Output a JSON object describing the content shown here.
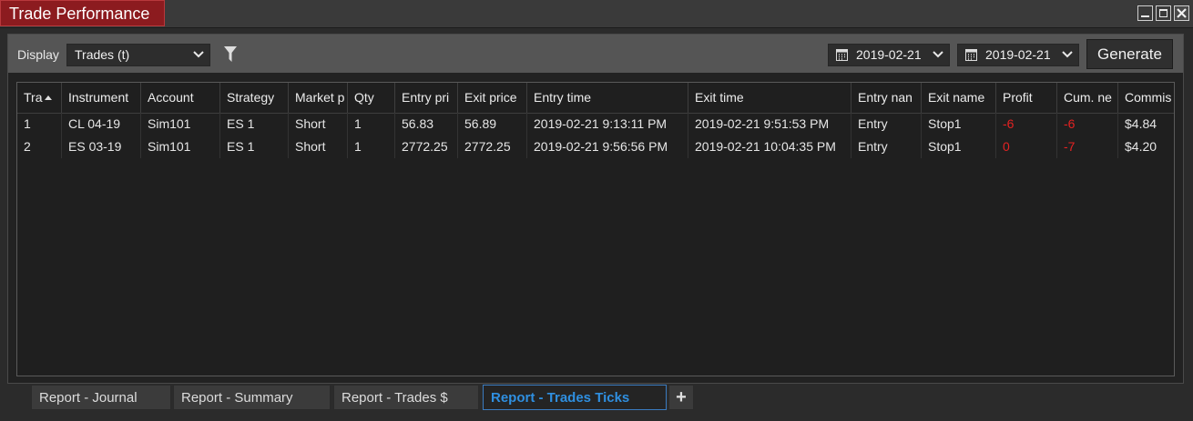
{
  "window": {
    "title": "Trade Performance"
  },
  "toolbar": {
    "display_label": "Display",
    "display_value": "Trades (t)",
    "date_from": "2019-02-21",
    "date_to": "2019-02-21",
    "generate_label": "Generate"
  },
  "grid": {
    "columns": [
      "Tra",
      "Instrument",
      "Account",
      "Strategy",
      "Market p",
      "Qty",
      "Entry pri",
      "Exit price",
      "Entry time",
      "Exit time",
      "Entry nan",
      "Exit name",
      "Profit",
      "Cum. ne",
      "Commis"
    ],
    "rows": [
      [
        "1",
        "CL 04-19",
        "Sim101",
        "ES 1",
        "Short",
        "1",
        "56.83",
        "56.89",
        "2019-02-21 9:13:11 PM",
        "2019-02-21 9:51:53 PM",
        "Entry",
        "Stop1",
        "-6",
        "-6",
        "$4.84"
      ],
      [
        "2",
        "ES 03-19",
        "Sim101",
        "ES 1",
        "Short",
        "1",
        "2772.25",
        "2772.25",
        "2019-02-21 9:56:56 PM",
        "2019-02-21 10:04:35 PM",
        "Entry",
        "Stop1",
        "0",
        "-7",
        "$4.20"
      ]
    ]
  },
  "tabs": [
    {
      "label": "Report - Journal"
    },
    {
      "label": "Report - Summary"
    },
    {
      "label": "Report - Trades $"
    },
    {
      "label": "Report - Trades Ticks"
    }
  ],
  "add_tab_label": "+",
  "colors": {
    "title_accent": "#8c1b1f",
    "negative": "#e42222",
    "active_tab": "#2f8fe0"
  },
  "icons": [
    "window-minimize-icon",
    "window-maximize-icon",
    "window-close-icon",
    "chevron-down-icon",
    "filter-icon",
    "calendar-icon",
    "sort-ascending-icon"
  ]
}
